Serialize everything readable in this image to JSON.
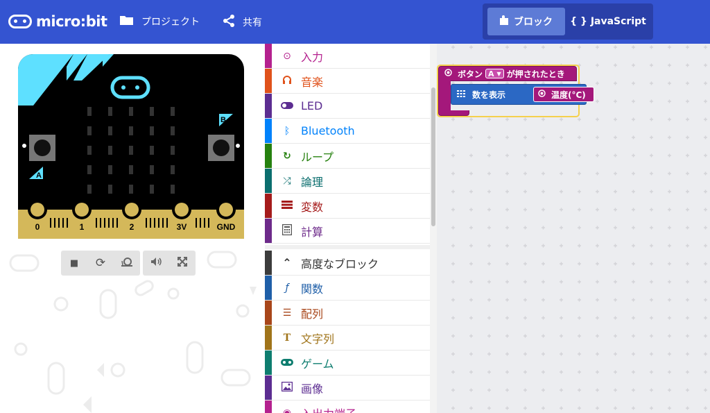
{
  "header": {
    "logo_text": "micro:bit",
    "nav": [
      {
        "label": "プロジェクト",
        "icon": "folder-icon"
      },
      {
        "label": "共有",
        "icon": "share-icon"
      }
    ],
    "editor_switch": {
      "blocks_label": "ブロック",
      "js_label": "{ } JavaScript",
      "active": "blocks"
    }
  },
  "simulator": {
    "board": {
      "pin_labels": [
        "0",
        "1",
        "2",
        "3V",
        "GND"
      ],
      "button_a": "A",
      "button_b": "B",
      "color_board": "#000000",
      "color_accent": "#5ee0ff",
      "color_pins": "#d4b85a"
    },
    "controls": [
      {
        "name": "stop-icon",
        "glyph": "■"
      },
      {
        "name": "restart-icon",
        "glyph": "⟳"
      },
      {
        "name": "slow-icon",
        "glyph": "🐌"
      },
      {
        "name": "mute-icon",
        "glyph": "🔊"
      },
      {
        "name": "fullscreen-icon",
        "glyph": "⛶"
      }
    ]
  },
  "toolbox": {
    "items": [
      {
        "label": "入力",
        "icon": "⊙",
        "color": "#b4218e"
      },
      {
        "label": "音楽",
        "icon": "🎧",
        "color": "#e0521b"
      },
      {
        "label": "LED",
        "icon": "◐",
        "color": "#5c2d91"
      },
      {
        "label": "Bluetooth",
        "icon": "ᛒ",
        "color": "#0082fb"
      },
      {
        "label": "ループ",
        "icon": "↻",
        "color": "#26810f"
      },
      {
        "label": "論理",
        "icon": "⤮",
        "color": "#0b6e6e"
      },
      {
        "label": "変数",
        "icon": "≡",
        "color": "#a51b1b"
      },
      {
        "label": "計算",
        "icon": "▦",
        "color": "#6d2a8a"
      }
    ],
    "advanced": [
      {
        "label": "高度なブロック",
        "icon": "⌃",
        "color": "#3c3c3c"
      },
      {
        "label": "関数",
        "icon": "ƒ",
        "color": "#1f5fa8"
      },
      {
        "label": "配列",
        "icon": "☰",
        "color": "#a8461a"
      },
      {
        "label": "文字列",
        "icon": "T",
        "color": "#a0741a"
      },
      {
        "label": "ゲーム",
        "icon": "◉",
        "color": "#0e7d6f"
      },
      {
        "label": "画像",
        "icon": "▣",
        "color": "#5c2d91"
      },
      {
        "label": "入出力端子",
        "icon": "◉",
        "color": "#b4218e"
      }
    ]
  },
  "workspace": {
    "event_block": {
      "prefix": "ボタン",
      "dropdown_value": "A",
      "suffix": "が押されたとき",
      "color": "#a4187b"
    },
    "show_block": {
      "label": "数を表示",
      "color": "#2b68c4"
    },
    "temp_block": {
      "label": "温度(°C)",
      "color": "#a4187b"
    }
  }
}
